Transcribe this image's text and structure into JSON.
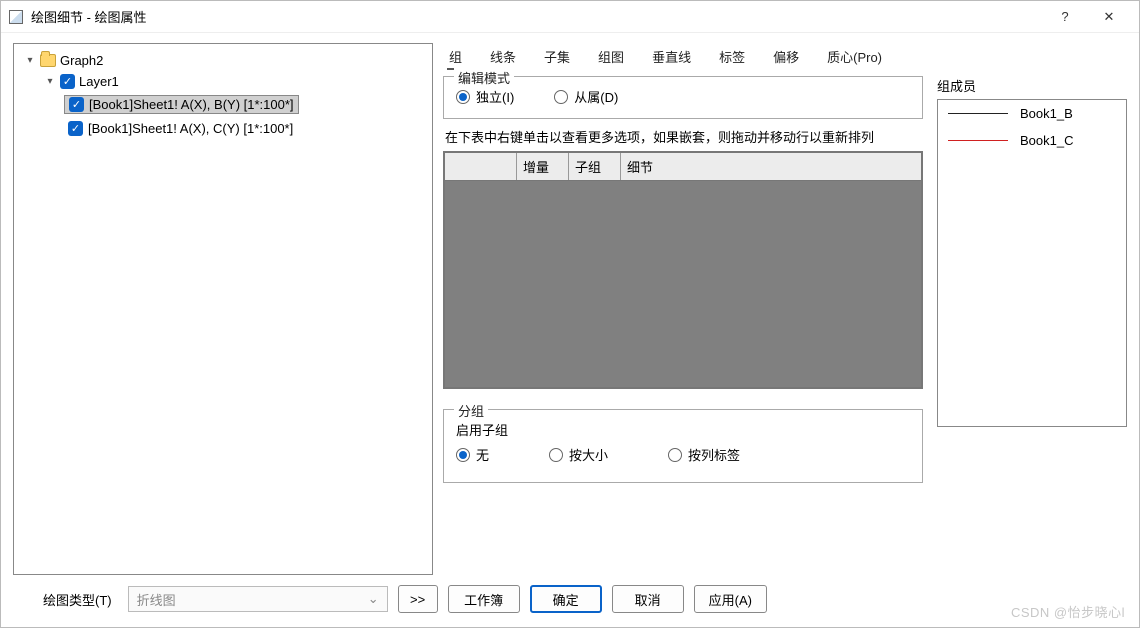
{
  "window": {
    "title": "绘图细节 - 绘图属性",
    "help": "?",
    "close": "✕"
  },
  "tree": {
    "root": "Graph2",
    "layer": "Layer1",
    "items": [
      "[Book1]Sheet1! A(X), B(Y) [1*:100*]",
      "[Book1]Sheet1! A(X), C(Y) [1*:100*]"
    ]
  },
  "tabs": [
    "组",
    "线条",
    "子集",
    "组图",
    "垂直线",
    "标签",
    "偏移",
    "质心(Pro)"
  ],
  "edit_mode": {
    "legend": "编辑模式",
    "independent": "独立(I)",
    "dependent": "从属(D)"
  },
  "hint": "在下表中右键单击以查看更多选项，如果嵌套，则拖动并移动行以重新排列",
  "grid_head": {
    "c1": "增量",
    "c2": "子组",
    "c3": "细节"
  },
  "grouping": {
    "legend": "分组",
    "enable": "启用子组",
    "none": "无",
    "by_size": "按大小",
    "by_label": "按列标签"
  },
  "members": {
    "legend": "组成员",
    "items": [
      {
        "label": "Book1_B",
        "color": "#222"
      },
      {
        "label": "Book1_C",
        "color": "#d02020"
      }
    ]
  },
  "footer": {
    "type_label": "绘图类型(T)",
    "type_value": "折线图",
    "expand": ">>",
    "workbook": "工作簿",
    "ok": "确定",
    "cancel": "取消",
    "apply": "应用(A)"
  },
  "watermark": "CSDN @怡步晓心l"
}
